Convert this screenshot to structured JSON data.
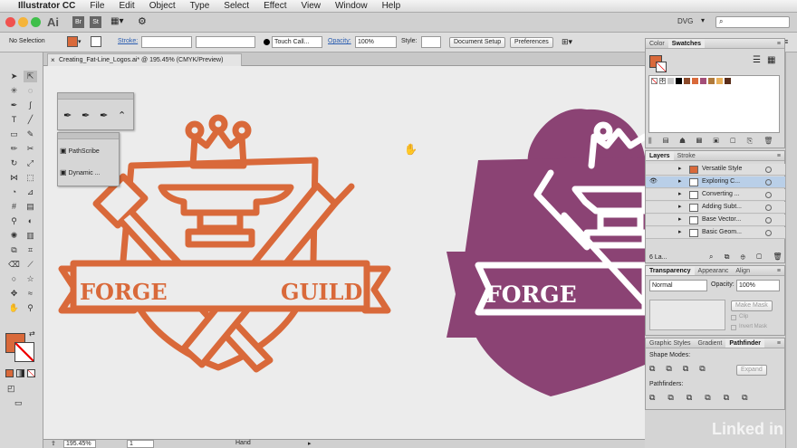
{
  "menubar": {
    "app": "Illustrator CC",
    "items": [
      "File",
      "Edit",
      "Object",
      "Type",
      "Select",
      "Effect",
      "View",
      "Window",
      "Help"
    ]
  },
  "appbar": {
    "logo": "Ai",
    "bridge": "Br",
    "stock": "St",
    "workspace": "DVG",
    "search_icon": "search-icon"
  },
  "control": {
    "selection": "No Selection",
    "stroke_label": "Stroke:",
    "brush": "Touch Call...",
    "opacity_label": "Opacity:",
    "opacity": "100%",
    "style_label": "Style:",
    "doc_setup": "Document Setup",
    "preferences": "Preferences"
  },
  "document": {
    "tab": "Creating_Fat-Line_Logos.ai* @ 195.45% (CMYK/Preview)"
  },
  "status": {
    "zoom": "195.45%",
    "artboard": "1",
    "tool": "Hand"
  },
  "art": {
    "left_word1": "FORGE",
    "left_word2": "GUILD",
    "right_word1": "FORGE",
    "left_color": "#d9693a",
    "right_color": "#8b4374"
  },
  "pen_panel": {
    "pathscribe": "PathScribe",
    "dynamic": "Dynamic ..."
  },
  "swatches": {
    "tab1": "Color",
    "tab2": "Swatches",
    "colors": [
      "#c8c8c8",
      "#000000",
      "#8b4a2b",
      "#d9693a",
      "#a34e78",
      "#b07a3a",
      "#e8b05a",
      "#5a2d1a"
    ]
  },
  "layers": {
    "tab1": "Layers",
    "tab2": "Stroke",
    "count": "6 La...",
    "items": [
      "Versatile Style",
      "Exploring C...",
      "Converting ...",
      "Adding Subt...",
      "Base Vector...",
      "Basic Geom..."
    ]
  },
  "transparency": {
    "tab1": "Transparency",
    "tab2": "Appearanc",
    "tab3": "Align",
    "mode": "Normal",
    "opacity_label": "Opacity:",
    "opacity": "100%",
    "make_mask": "Make Mask",
    "clip": "Clip",
    "invert": "Invert Mask"
  },
  "pathfinder": {
    "tab1": "Graphic Styles",
    "tab2": "Gradient",
    "tab3": "Pathfinder",
    "shape_modes": "Shape Modes:",
    "expand": "Expand",
    "pathfinders": "Pathfinders:"
  },
  "watermark": "Linked in"
}
